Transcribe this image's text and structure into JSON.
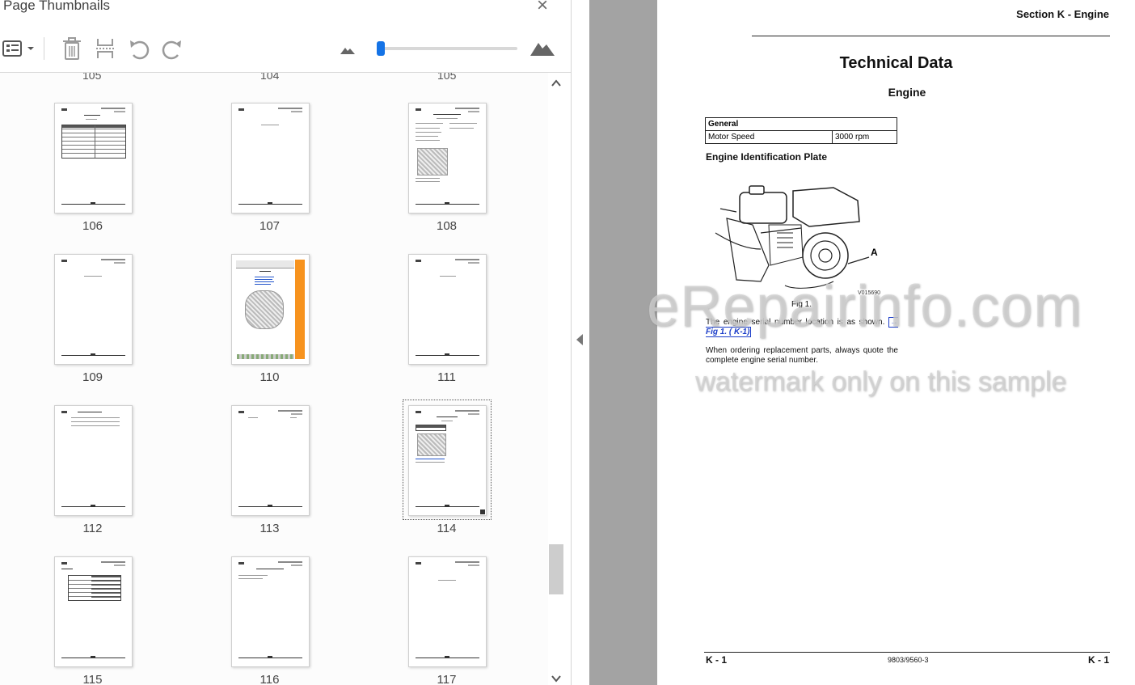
{
  "panel": {
    "title": "Page Thumbnails",
    "close_icon": "×",
    "toolbar": {
      "options_icon": "list-options-icon",
      "delete_icon": "trash-icon",
      "extract_icon": "extract-pages-icon",
      "rotate_ccw_icon": "rotate-counterclockwise-icon",
      "rotate_cw_icon": "rotate-clockwise-icon",
      "zoom_level": 0.02
    },
    "top_partial_labels": [
      "105",
      "104",
      "105"
    ],
    "thumbnails": [
      {
        "label": "106"
      },
      {
        "label": "107"
      },
      {
        "label": "108"
      },
      {
        "label": "109"
      },
      {
        "label": "110"
      },
      {
        "label": "111"
      },
      {
        "label": "112"
      },
      {
        "label": "113"
      },
      {
        "label": "114"
      },
      {
        "label": "115"
      },
      {
        "label": "116"
      },
      {
        "label": "117"
      }
    ],
    "selected_page": "114",
    "accent_color": "#1473e6"
  },
  "document": {
    "section_header": "Section K - Engine",
    "title": "Technical Data",
    "subtitle": "Engine",
    "table": {
      "header": "General",
      "rows": [
        {
          "label": "Motor Speed",
          "value": "3000 rpm"
        }
      ]
    },
    "plate_heading": "Engine Identification Plate",
    "figure_callout": "A",
    "figure_code": "V015690",
    "figure_caption": "Fig 1.",
    "para1_text": "The engine serial number location is as shown.",
    "para1_link": "→ Fig 1. ( K-1)",
    "para2_text": "When ordering replacement parts, always quote the complete engine serial number.",
    "footer_left": "K - 1",
    "footer_mid": "9803/9560-3",
    "footer_right": "K - 1"
  },
  "watermark": {
    "line1": "eRepairinfo.com",
    "line2": "watermark only on this sample"
  }
}
